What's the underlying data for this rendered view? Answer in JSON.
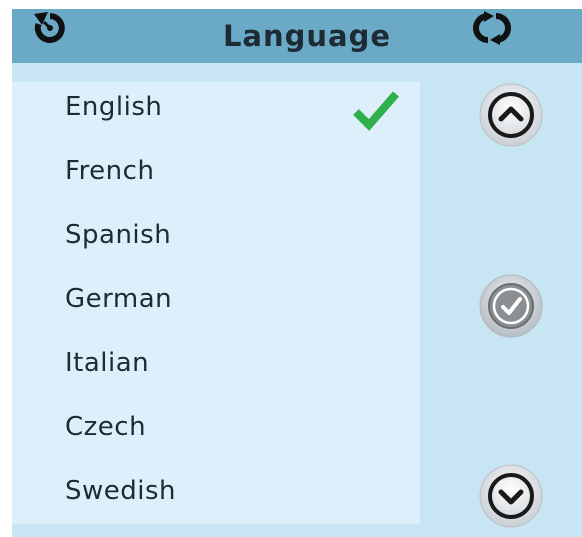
{
  "header": {
    "title": "Language",
    "back_icon": "back-icon",
    "refresh_icon": "refresh-icon"
  },
  "languages": [
    {
      "label": "English",
      "selected": true
    },
    {
      "label": "French",
      "selected": false
    },
    {
      "label": "Spanish",
      "selected": false
    },
    {
      "label": "German",
      "selected": false
    },
    {
      "label": "Italian",
      "selected": false
    },
    {
      "label": "Czech",
      "selected": false
    },
    {
      "label": "Swedish",
      "selected": false
    }
  ],
  "controls": {
    "scroll_up_icon": "chevron-up-icon",
    "confirm_icon": "check-icon",
    "scroll_down_icon": "chevron-down-icon"
  },
  "colors": {
    "header_bg": "#6aaac6",
    "page_bg": "#c8e5f4",
    "list_bg": "#ddeffa",
    "check_green": "#2eb04a",
    "text": "#1e2b35"
  }
}
